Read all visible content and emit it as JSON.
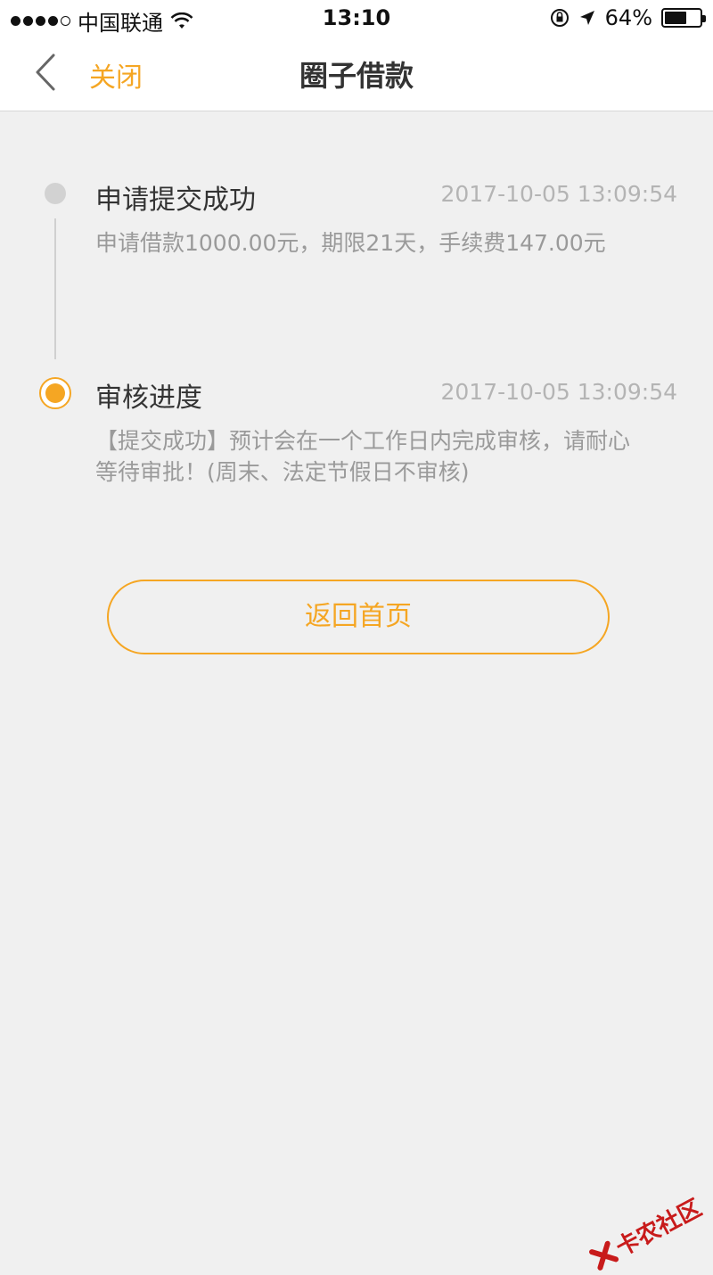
{
  "status_bar": {
    "carrier": "中国联通",
    "time": "13:10",
    "battery": "64%",
    "battery_level": 0.64,
    "icons": [
      "signal-dots-icon",
      "wifi-icon",
      "rotation-lock-icon",
      "location-arrow-icon",
      "battery-icon"
    ]
  },
  "navbar": {
    "back_icon": "chevron-left-icon",
    "close_label": "关闭",
    "title": "圈子借款"
  },
  "timeline": [
    {
      "title": "申请提交成功",
      "time": "2017-10-05 13:09:54",
      "description": "申请借款1000.00元，期限21天，手续费147.00元",
      "state": "done"
    },
    {
      "title": "审核进度",
      "time": "2017-10-05 13:09:54",
      "description_line1": "【提交成功】预计会在一个工作日内完成审核，请耐心",
      "description_line2": "等待审批！(周末、法定节假日不审核)",
      "state": "active"
    }
  ],
  "actions": {
    "home_label": "返回首页"
  },
  "colors": {
    "accent": "#f5a623",
    "background": "#f0f0f0",
    "title_text": "#333333",
    "secondary_text": "#9a9a9a"
  },
  "watermark": {
    "text": "卡农社区"
  }
}
